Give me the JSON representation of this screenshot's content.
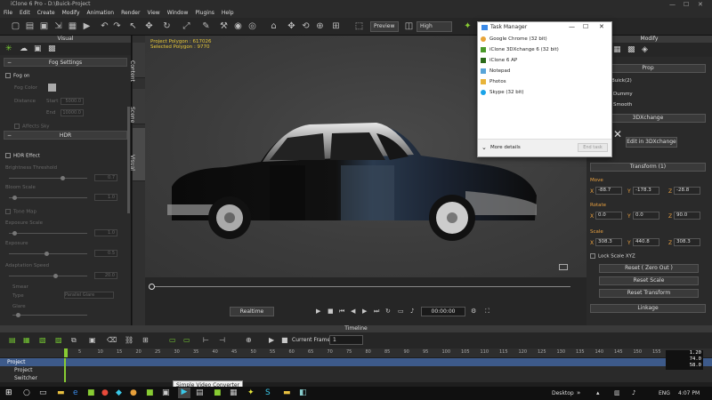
{
  "window": {
    "title": "iClone 6 Pro - D:\\Buick-Project",
    "minimize": "—",
    "maximize": "☐",
    "close": "✕"
  },
  "menu": [
    "File",
    "Edit",
    "Create",
    "Modify",
    "Animation",
    "Render",
    "View",
    "Window",
    "Plugins",
    "Help"
  ],
  "toolbar": {
    "preview": "Preview",
    "quality": "High"
  },
  "visual_panel": {
    "title": "Visual",
    "fog": {
      "section": "Fog Settings",
      "fog_on": "Fog on",
      "fog_color": "Fog Color",
      "distance": "Distance",
      "start": "Start",
      "start_val": "5000.0",
      "end": "End",
      "end_val": "10000.0",
      "affects_sky": "Affects Sky"
    },
    "hdr": {
      "section": "HDR",
      "hdr_effect": "HDR Effect",
      "brightness": "Brightness Threshold",
      "brightness_val": "0.7",
      "bloom_scale": "Bloom Scale",
      "bloom_val": "1.0",
      "tone_map": "Tone Map",
      "exposure_scale": "Exposure Scale",
      "exposure_val": "1.0",
      "exposure_b": "Exposure",
      "exposure_b_val": "0.5",
      "adaptation": "Adaptation Speed",
      "adaptation_val": "20.0",
      "smear": "Smear",
      "type": "Type",
      "type_val": "Parallel Glare",
      "glare": "Glare"
    }
  },
  "side_tabs": [
    "Content",
    "Scene",
    "Visual"
  ],
  "viewport": {
    "project_polygon": "Project Polygon : 617026",
    "selected_polygon": "Selected Polygon : 9770",
    "timecode": "00:00:00",
    "realtime": "Realtime"
  },
  "modify_panel": {
    "title": "Modify",
    "prop": "Prop",
    "name": "Buick(2)",
    "dummy": "Dummy",
    "smooth": "Smooth",
    "threedx": "3DXchange",
    "edit3dx": "Edit in 3DXchange",
    "transform": "Transform  (1)",
    "move": "Move",
    "move_x": "-88.7",
    "move_y": "-178.3",
    "move_z": "-28.8",
    "rotate": "Rotate",
    "rot_x": "0.0",
    "rot_y": "0.0",
    "rot_z": "90.0",
    "scale": "Scale",
    "scale_x": "308.3",
    "scale_y": "440.8",
    "scale_z": "308.3",
    "lock_scale": "Lock Scale XYZ",
    "reset_zero": "Reset ( Zero Out )",
    "reset_scale": "Reset Scale",
    "reset_transform": "Reset Transform",
    "linkage": "Linkage"
  },
  "timeline": {
    "title": "Timeline",
    "current_frame_label": "Current Frame :",
    "current_frame": "1",
    "ticks": [
      "5",
      "10",
      "15",
      "20",
      "25",
      "30",
      "35",
      "40",
      "45",
      "50",
      "55",
      "60",
      "65",
      "70",
      "75",
      "80",
      "85",
      "90",
      "95",
      "100",
      "105",
      "110",
      "115",
      "120",
      "125",
      "130",
      "135",
      "140",
      "145",
      "150",
      "155"
    ],
    "tracks": [
      "Project",
      "Project",
      "Switcher"
    ],
    "fps": "1.20",
    "fps2": "74.0",
    "fps3": "58.0"
  },
  "task_manager": {
    "title": "Task Manager",
    "items": [
      "Google Chrome (32 bit)",
      "iClone 3DXchange 6 (32 bit)",
      "iClone 6 AP",
      "Notepad",
      "Photos",
      "Skype (32 bit)"
    ],
    "icon_colors": [
      "#e8a53a",
      "#4a9a2a",
      "#2a6a1a",
      "#58a4d8",
      "#e8b43a",
      "#1aa3e8"
    ],
    "more_details": "More details",
    "end_task": "End task"
  },
  "tooltip": "Simple Video Converter",
  "taskbar": {
    "desktop": "Desktop",
    "lang": "ENG",
    "time": "4:07 PM"
  }
}
